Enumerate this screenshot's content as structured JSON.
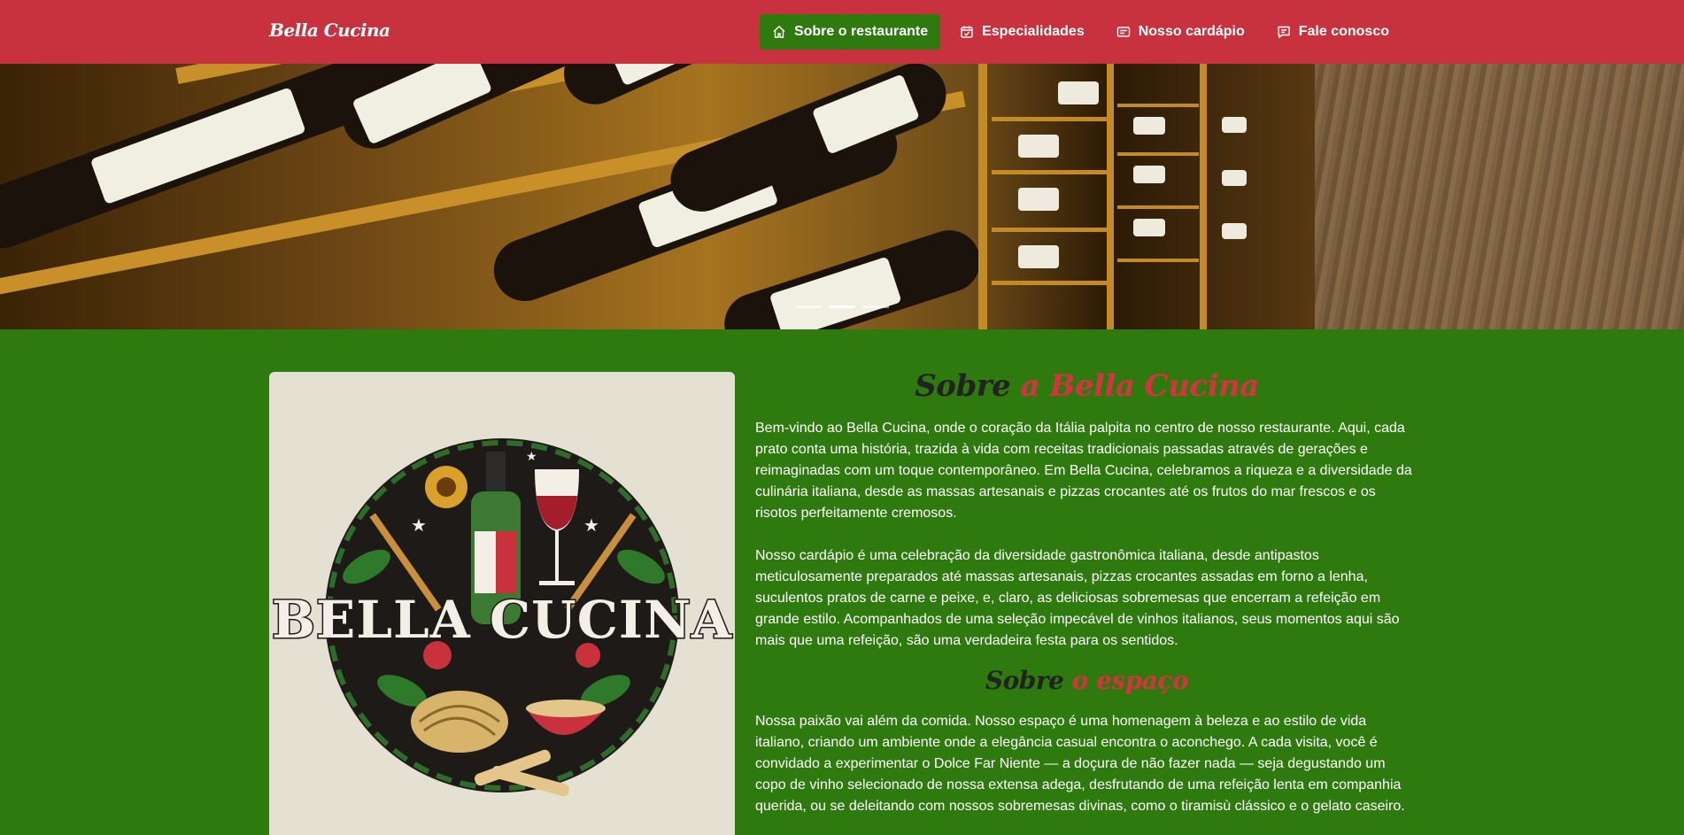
{
  "brand": "Bella Cucina",
  "nav": {
    "items": [
      {
        "label": "Sobre o restaurante",
        "icon": "home-icon",
        "active": true
      },
      {
        "label": "Especialidades",
        "icon": "calendar-check-icon",
        "active": false
      },
      {
        "label": "Nosso cardápio",
        "icon": "list-card-icon",
        "active": false
      },
      {
        "label": "Fale conosco",
        "icon": "chat-icon",
        "active": false
      }
    ]
  },
  "hero": {
    "image": "wine-cellar-photo",
    "slide_count": 3,
    "active_slide": 2
  },
  "logo": {
    "image": "bella-cucina-logo",
    "text": "BELLA CUCINA"
  },
  "about": {
    "title_dark": "Sobre",
    "title_red": "a Bella Cucina",
    "paragraph1": "Bem-vindo ao Bella Cucina, onde o coração da Itália palpita no centro de nosso restaurante. Aqui, cada prato conta uma história, trazida à vida com receitas tradicionais passadas através de gerações e reimaginadas com um toque contemporâneo. Em Bella Cucina, celebramos a riqueza e a diversidade da culinária italiana, desde as massas artesanais e pizzas crocantes até os frutos do mar frescos e os risotos perfeitamente cremosos.",
    "paragraph2": "Nosso cardápio é uma celebração da diversidade gastronômica italiana, desde antipastos meticulosamente preparados até massas artesanais, pizzas crocantes assadas em forno a lenha, suculentos pratos de carne e peixe, e, claro, as deliciosas sobremesas que encerram a refeição em grande estilo. Acompanhados de uma seleção impecável de vinhos italianos, seus momentos aqui são mais que uma refeição, são uma verdadeira festa para os sentidos."
  },
  "space": {
    "title_dark": "Sobre",
    "title_red": "o espaço",
    "paragraph1": "Nossa paixão vai além da comida. Nosso espaço é uma homenagem à beleza e ao estilo de vida italiano, criando um ambiente onde a elegância casual encontra o aconchego. A cada visita, você é convidado a experimentar o Dolce Far Niente — a doçura de não fazer nada — seja degustando um copo de vinho selecionado de nossa extensa adega, desfrutando de uma refeição lenta em companhia querida, ou se deleitando com nossos sobremesas divinas, como o tiramisù clássico e o gelato caseiro."
  },
  "colors": {
    "navbar": "#c8323f",
    "active_nav": "#2e7a0e",
    "page_bg": "#2e7a0e",
    "title_dark": "#222222",
    "title_red": "#d4343f",
    "logo_card": "#e4e1d3"
  }
}
